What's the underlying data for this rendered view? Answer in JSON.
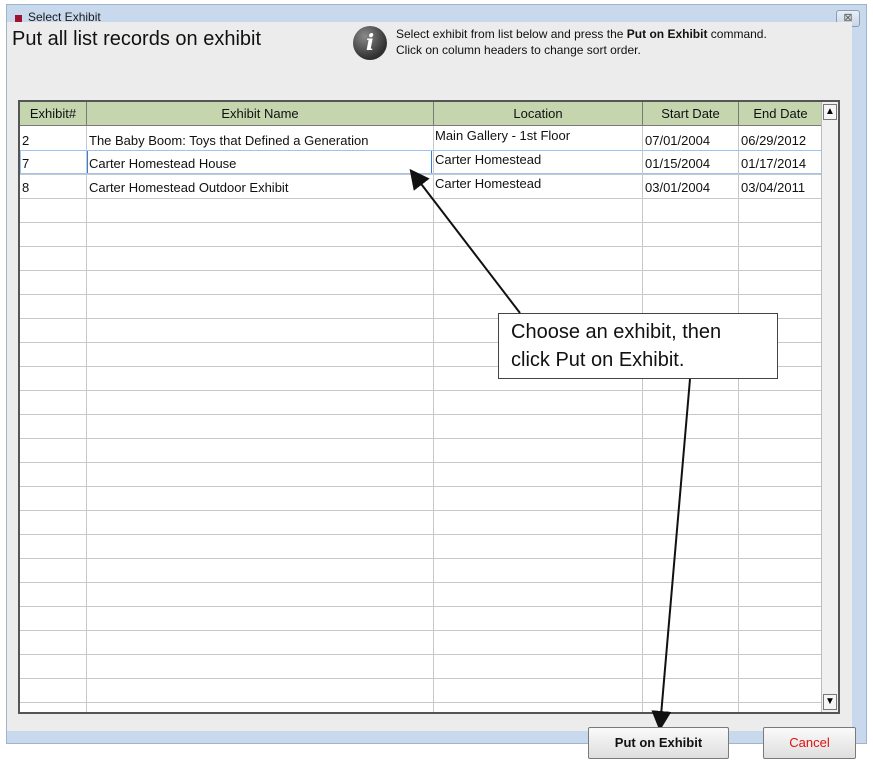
{
  "window": {
    "title": "Select Exhibit",
    "close_glyph": "⊠"
  },
  "header": {
    "title": "Put all list records on exhibit",
    "info_glyph": "i",
    "instruction_pre": "Select exhibit from list below and press the ",
    "instruction_bold": "Put on Exhibit",
    "instruction_post": " command.",
    "instruction_line2": "Click on column headers to change sort order."
  },
  "table": {
    "columns": [
      "Exhibit#",
      "Exhibit Name",
      "Location",
      "Start Date",
      "End Date"
    ],
    "rows": [
      {
        "id": "2",
        "name": "The Baby Boom: Toys that Defined a Generation",
        "location": "Main Gallery - 1st Floor",
        "start": "07/01/2004",
        "end": "06/29/2012"
      },
      {
        "id": "7",
        "name": "Carter Homestead House",
        "location": "Carter Homestead",
        "start": "01/15/2004",
        "end": "01/17/2014"
      },
      {
        "id": "8",
        "name": "Carter Homestead Outdoor Exhibit",
        "location": "Carter Homestead",
        "start": "03/01/2004",
        "end": "03/04/2011"
      }
    ],
    "selected_row": 1
  },
  "callout": {
    "line1": "Choose an exhibit, then",
    "line2": "click Put on Exhibit."
  },
  "buttons": {
    "put_label": "Put on Exhibit",
    "cancel_label": "Cancel"
  },
  "colors": {
    "header_bg": "#c5d5ae",
    "cancel_text": "#e01010",
    "selection": "#3a7fd6"
  }
}
